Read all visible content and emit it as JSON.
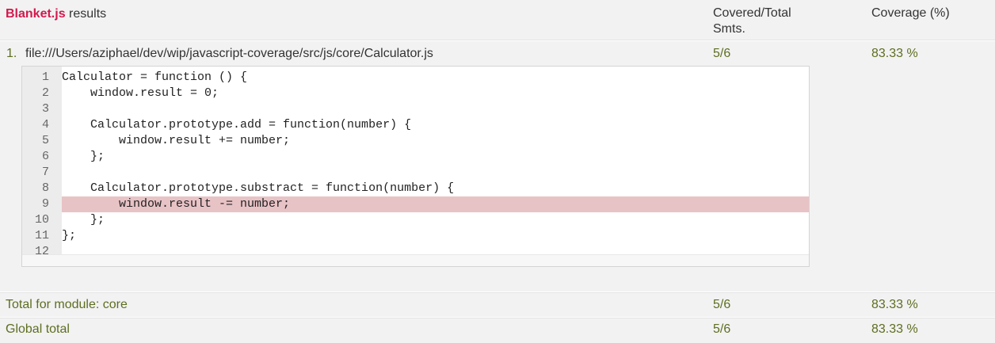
{
  "header": {
    "brand": "Blanket.js",
    "title_rest": " results",
    "col_covered": "Covered/Total",
    "col_covered2": "Smts.",
    "col_coverage": "Coverage (%)"
  },
  "file": {
    "index": "1.",
    "path": "file:///Users/aziphael/dev/wip/javascript-coverage/src/js/core/Calculator.js",
    "covered": "5/6",
    "coverage": "83.33 %"
  },
  "code": [
    {
      "n": "1",
      "text": "Calculator = function () {",
      "miss": false
    },
    {
      "n": "2",
      "text": "    window.result = 0;",
      "miss": false
    },
    {
      "n": "3",
      "text": "",
      "miss": false
    },
    {
      "n": "4",
      "text": "    Calculator.prototype.add = function(number) {",
      "miss": false
    },
    {
      "n": "5",
      "text": "        window.result += number;",
      "miss": false
    },
    {
      "n": "6",
      "text": "    };",
      "miss": false
    },
    {
      "n": "7",
      "text": "",
      "miss": false
    },
    {
      "n": "8",
      "text": "    Calculator.prototype.substract = function(number) {",
      "miss": false
    },
    {
      "n": "9",
      "text": "        window.result -= number;",
      "miss": true
    },
    {
      "n": "10",
      "text": "    };",
      "miss": false
    },
    {
      "n": "11",
      "text": "};",
      "miss": false
    },
    {
      "n": "12",
      "text": "",
      "miss": false
    }
  ],
  "module_total": {
    "label": "Total for module: core",
    "covered": "5/6",
    "coverage": "83.33 %"
  },
  "global_total": {
    "label": "Global total",
    "covered": "5/6",
    "coverage": "83.33 %"
  }
}
